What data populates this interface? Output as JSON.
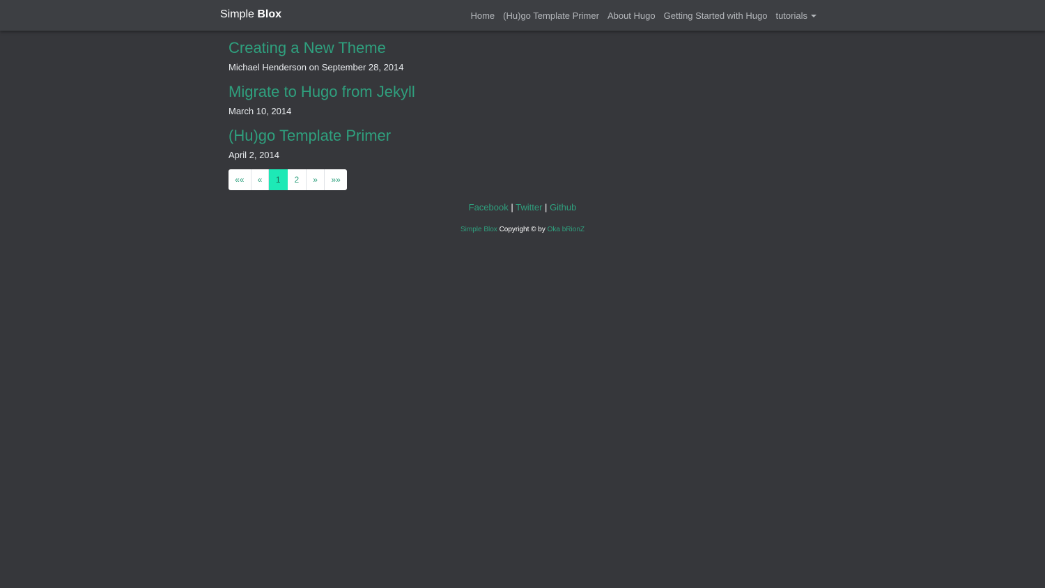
{
  "navbar": {
    "brand_light": "Simple",
    "brand_bold": "Blox",
    "links": [
      {
        "label": "Home"
      },
      {
        "label": "(Hu)go Template Primer"
      },
      {
        "label": "About Hugo"
      },
      {
        "label": "Getting Started with Hugo"
      },
      {
        "label": "tutorials"
      }
    ]
  },
  "posts": [
    {
      "title": "Creating a New Theme",
      "meta": "Michael Henderson on September 28, 2014"
    },
    {
      "title": "Migrate to Hugo from Jekyll",
      "meta": "March 10, 2014"
    },
    {
      "title": "(Hu)go Template Primer",
      "meta": "April 2, 2014"
    }
  ],
  "pagination": {
    "first": "««",
    "prev": "«",
    "pages": [
      "1",
      "2"
    ],
    "next": "»",
    "last": "»»",
    "active_page": "1"
  },
  "footer": {
    "links": [
      "Facebook",
      "Twitter",
      "Github"
    ],
    "separator": "|",
    "site_name": "Simple Blox",
    "copyright_text": "Copyright © by",
    "author": "Oka bRionZ"
  },
  "colors": {
    "accent": "#2fa07e",
    "active_page": "#1de9b6",
    "background": "#36373b",
    "navbar": "#3d3f43"
  }
}
